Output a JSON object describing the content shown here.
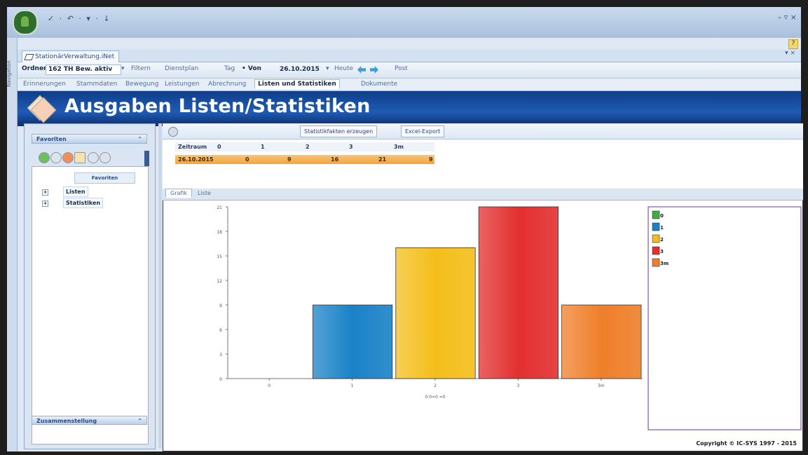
{
  "titlebar": {
    "quick_access": "✓ · ↶ · ▾ · ↓",
    "win_controls": "– ▿ ×",
    "help": "?"
  },
  "sidetab_label": "Navigation",
  "document_tab": {
    "label": "StationärVerwaltung.iNet",
    "close": "▾ ×"
  },
  "toolbar": {
    "ordner_label": "Ordner",
    "ordner_value": "162 TH Bew. aktiv",
    "filtern": "Filtern",
    "dienstplan": "Dienstplan",
    "tag": "Tag",
    "von_label": "• Von",
    "date": "26.10.2015",
    "date_arrow": "▾",
    "heute": "Heute",
    "post": "Post"
  },
  "nav_tabs": [
    "Erinnerungen",
    "Stammdaten",
    "Bewegung",
    "Leistungen",
    "Abrechnung",
    "Listen und Statistiken",
    "Dokumente"
  ],
  "header": {
    "title": "Ausgaben Listen/Statistiken"
  },
  "left_panel": {
    "favorites_label": "Favoriten",
    "favorites_collapse": "⌃",
    "tree_header": "Favoriten",
    "tree": [
      {
        "plus": "+",
        "label": "Listen"
      },
      {
        "plus": "+",
        "label": "Statistiken"
      }
    ],
    "bottom_label": "Zusammenstellung",
    "bottom_collapse": "⌃"
  },
  "right_toolbar": {
    "generate": "Statistikfakten erzeugen",
    "excel": "Excel-Export"
  },
  "stats_table": {
    "headers": [
      "Zeitraum",
      "0",
      "1",
      "2",
      "3",
      "3m"
    ],
    "row": [
      "26.10.2015",
      "0",
      "9",
      "16",
      "21",
      "9"
    ]
  },
  "view_tabs": [
    "Grafik",
    "Liste"
  ],
  "chart_data": {
    "type": "bar",
    "categories": [
      "0",
      "1",
      "2",
      "3",
      "3m"
    ],
    "values": [
      0,
      9,
      16,
      21,
      9
    ],
    "colors": [
      "#3fae3f",
      "#1a82c7",
      "#f4be1a",
      "#e32f2f",
      "#ef7f2a"
    ],
    "yticks": [
      "0",
      "3",
      "6",
      "9",
      "12",
      "15",
      "18",
      "21"
    ],
    "ylim": [
      0,
      21
    ],
    "xlabel": "0:0=0 =0",
    "legend": [
      "0",
      "1",
      "2",
      "3",
      "3m"
    ],
    "legend_position": "right",
    "grid": false
  },
  "copyright": "Copyright © IC-SYS 1997 - 2015"
}
